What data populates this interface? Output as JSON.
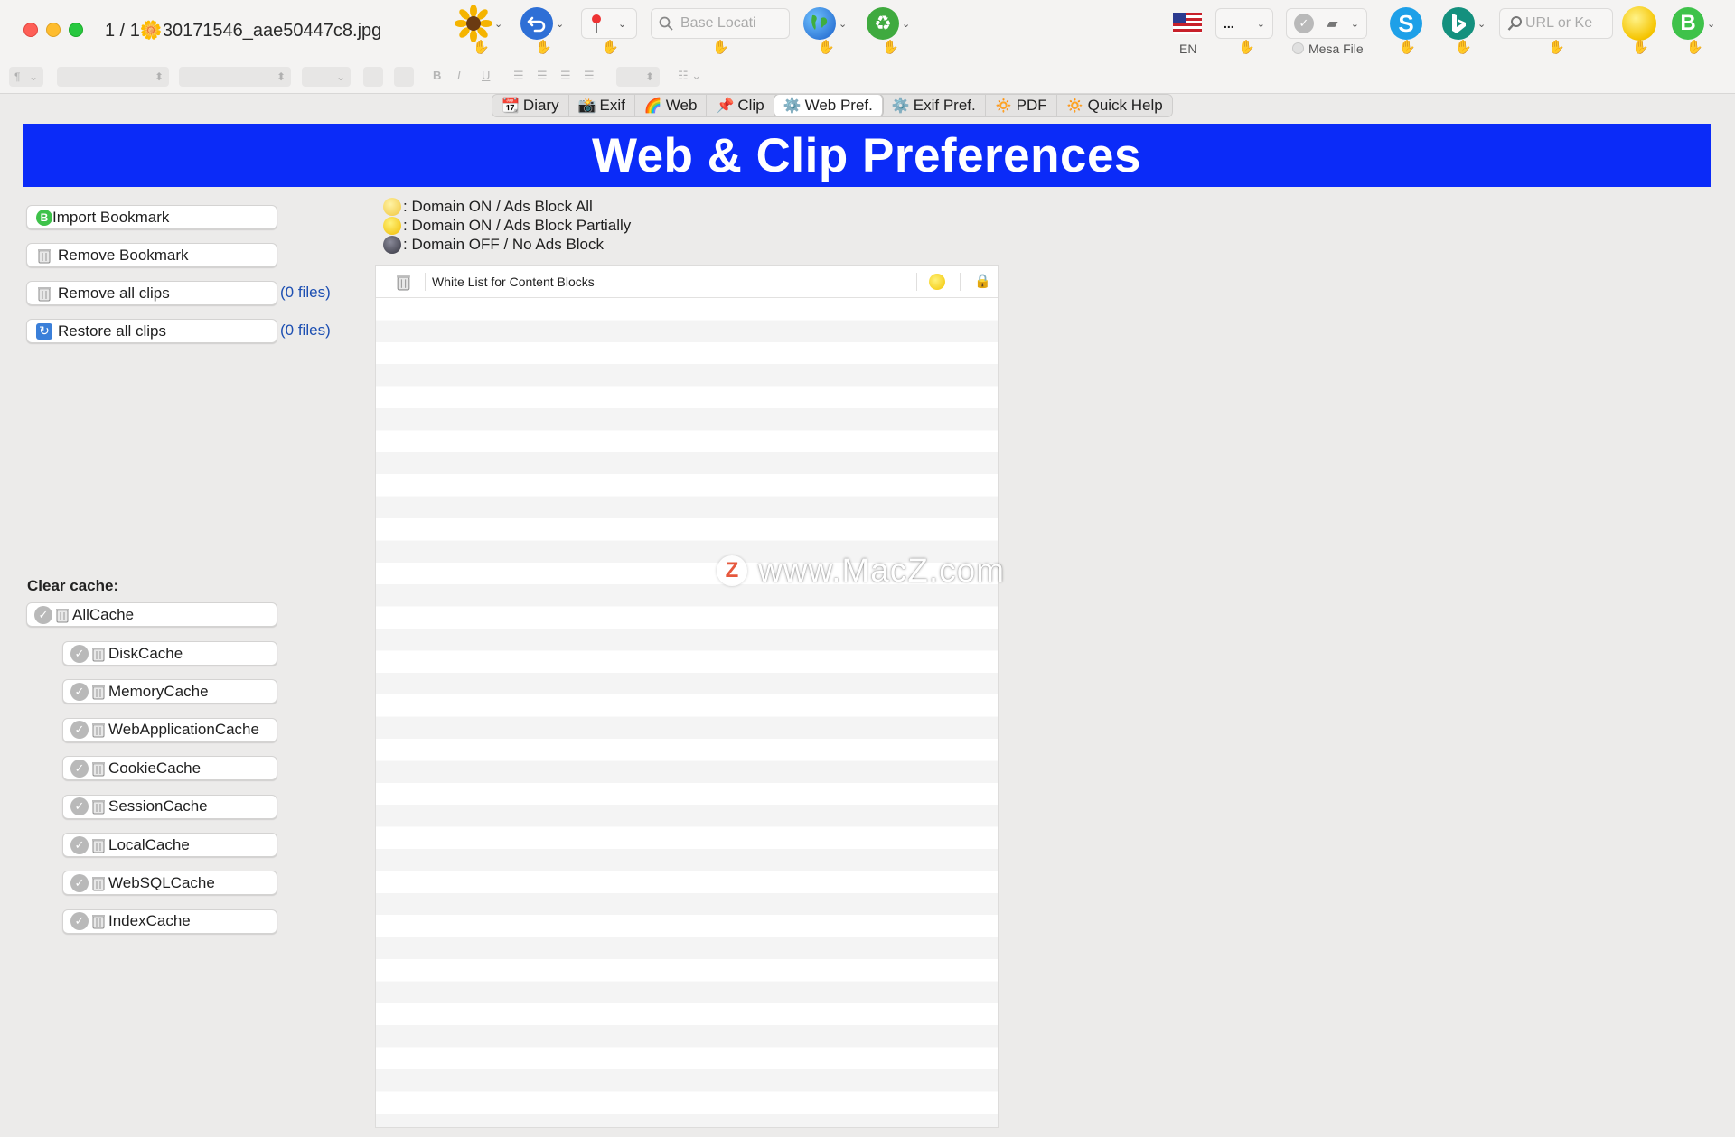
{
  "window": {
    "title": "1 / 1🌼30171546_aae50447c8.jpg",
    "controls": [
      "close",
      "minimize",
      "zoom"
    ]
  },
  "toolbar": {
    "search_placeholder": "Base Locati",
    "url_placeholder": "URL or Ke",
    "language_label": "EN",
    "menu_value": "...",
    "mesa_file_label": "Mesa File",
    "hand_glyph": "✋",
    "icons": [
      "sunflower-icon",
      "back-arrow-icon",
      "pin-icon",
      "globe-icon",
      "recycle-icon",
      "us-flag-icon",
      "skype-icon",
      "bing-icon",
      "sun-icon",
      "b-circle-icon"
    ],
    "bing_letter": "B",
    "skype_letter": "S"
  },
  "formatbar": {
    "paragraph_glyph": "¶",
    "bold": "B",
    "italic": "I",
    "underline": "U"
  },
  "tabs": [
    {
      "icon": "📆",
      "label": "Diary"
    },
    {
      "icon": "📸",
      "label": "Exif"
    },
    {
      "icon": "🌈",
      "label": "Web"
    },
    {
      "icon": "📌",
      "label": "Clip"
    },
    {
      "icon": "⚙️",
      "label": "Web Pref.",
      "active": true
    },
    {
      "icon": "⚙️",
      "label": "Exif Pref."
    },
    {
      "icon": "🔅",
      "label": "PDF"
    },
    {
      "icon": "🔅",
      "label": "Quick Help"
    }
  ],
  "banner": {
    "title": "Web & Clip Preferences",
    "color": "#0b2bf8"
  },
  "actions": {
    "import_bookmark": "Import Bookmark",
    "remove_bookmark": "Remove Bookmark",
    "remove_all_clips": "Remove all clips",
    "remove_all_clips_count": "(0 files)",
    "restore_all_clips": "Restore all clips",
    "restore_all_clips_count": "(0 files)"
  },
  "cache": {
    "label": "Clear cache:",
    "all": "AllCache",
    "items": [
      "DiskCache",
      "MemoryCache",
      "WebApplicationCache",
      "CookieCache",
      "SessionCache",
      "LocalCache",
      "WebSQLCache",
      "IndexCache"
    ]
  },
  "legend": [
    {
      "text": ": Domain ON  / Ads Block All",
      "dot_color": "#f7d24a"
    },
    {
      "text": ": Domain ON  / Ads Block Partially",
      "dot_color": "#f4c20d"
    },
    {
      "text": ": Domain OFF / No Ads Block",
      "dot_color": "#4a4a55"
    }
  ],
  "whitelist": {
    "header": "White List for Content Blocks",
    "rows": []
  },
  "watermark": {
    "logo": "Z",
    "text": "www.MacZ.com"
  }
}
